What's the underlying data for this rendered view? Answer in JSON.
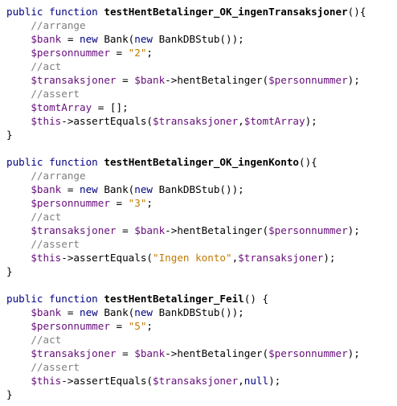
{
  "colors": {
    "keyword": "#000080",
    "variable": "#660e7a",
    "string": "#c07a00",
    "comment": "#808080",
    "background": "#ffffff",
    "text": "#000000"
  },
  "lines": [
    {
      "indent": false,
      "tokens": [
        [
          "kw",
          "public"
        ],
        [
          "p",
          " "
        ],
        [
          "kw",
          "function"
        ],
        [
          "p",
          " "
        ],
        [
          "fn",
          "testHentBetalinger_OK_ingenTransaksjoner"
        ],
        [
          "p",
          "(){"
        ]
      ]
    },
    {
      "indent": true,
      "tokens": [
        [
          "c",
          "//arrange"
        ]
      ]
    },
    {
      "indent": true,
      "tokens": [
        [
          "v",
          "$bank"
        ],
        [
          "p",
          " = "
        ],
        [
          "kw",
          "new"
        ],
        [
          "p",
          " Bank("
        ],
        [
          "kw",
          "new"
        ],
        [
          "p",
          " BankDBStub());"
        ]
      ]
    },
    {
      "indent": true,
      "tokens": [
        [
          "v",
          "$personnummer"
        ],
        [
          "p",
          " = "
        ],
        [
          "s",
          "\"2\""
        ],
        [
          "p",
          ";"
        ]
      ]
    },
    {
      "indent": true,
      "tokens": [
        [
          "c",
          "//act"
        ]
      ]
    },
    {
      "indent": true,
      "tokens": [
        [
          "v",
          "$transaksjoner"
        ],
        [
          "p",
          " = "
        ],
        [
          "v",
          "$bank"
        ],
        [
          "p",
          "->hentBetalinger("
        ],
        [
          "v",
          "$personnummer"
        ],
        [
          "p",
          ");"
        ]
      ]
    },
    {
      "indent": true,
      "tokens": [
        [
          "c",
          "//assert"
        ]
      ]
    },
    {
      "indent": true,
      "tokens": [
        [
          "v",
          "$tomtArray"
        ],
        [
          "p",
          " = [];"
        ]
      ]
    },
    {
      "indent": true,
      "tokens": [
        [
          "v",
          "$this"
        ],
        [
          "p",
          "->assertEquals("
        ],
        [
          "v",
          "$transaksjoner"
        ],
        [
          "p",
          ","
        ],
        [
          "v",
          "$tomtArray"
        ],
        [
          "p",
          ");"
        ]
      ]
    },
    {
      "indent": false,
      "tokens": [
        [
          "p",
          "}"
        ]
      ]
    },
    {
      "indent": false,
      "tokens": []
    },
    {
      "indent": false,
      "tokens": [
        [
          "kw",
          "public"
        ],
        [
          "p",
          " "
        ],
        [
          "kw",
          "function"
        ],
        [
          "p",
          " "
        ],
        [
          "fn",
          "testHentBetalinger_OK_ingenKonto"
        ],
        [
          "p",
          "(){"
        ]
      ]
    },
    {
      "indent": true,
      "tokens": [
        [
          "c",
          "//arrange"
        ]
      ]
    },
    {
      "indent": true,
      "tokens": [
        [
          "v",
          "$bank"
        ],
        [
          "p",
          " = "
        ],
        [
          "kw",
          "new"
        ],
        [
          "p",
          " Bank("
        ],
        [
          "kw",
          "new"
        ],
        [
          "p",
          " BankDBStub());"
        ]
      ]
    },
    {
      "indent": true,
      "tokens": [
        [
          "v",
          "$personnummer"
        ],
        [
          "p",
          " = "
        ],
        [
          "s",
          "\"3\""
        ],
        [
          "p",
          ";"
        ]
      ]
    },
    {
      "indent": true,
      "tokens": [
        [
          "c",
          "//act"
        ]
      ]
    },
    {
      "indent": true,
      "tokens": [
        [
          "v",
          "$transaksjoner"
        ],
        [
          "p",
          " = "
        ],
        [
          "v",
          "$bank"
        ],
        [
          "p",
          "->hentBetalinger("
        ],
        [
          "v",
          "$personnummer"
        ],
        [
          "p",
          ");"
        ]
      ]
    },
    {
      "indent": true,
      "tokens": [
        [
          "c",
          "//assert"
        ]
      ]
    },
    {
      "indent": true,
      "tokens": [
        [
          "v",
          "$this"
        ],
        [
          "p",
          "->assertEquals("
        ],
        [
          "s",
          "\"Ingen konto\""
        ],
        [
          "p",
          ","
        ],
        [
          "v",
          "$transaksjoner"
        ],
        [
          "p",
          ");"
        ]
      ]
    },
    {
      "indent": false,
      "tokens": [
        [
          "p",
          "}"
        ]
      ]
    },
    {
      "indent": false,
      "tokens": []
    },
    {
      "indent": false,
      "tokens": [
        [
          "kw",
          "public"
        ],
        [
          "p",
          " "
        ],
        [
          "kw",
          "function"
        ],
        [
          "p",
          " "
        ],
        [
          "fn",
          "testHentBetalinger_Feil"
        ],
        [
          "p",
          "() {"
        ]
      ]
    },
    {
      "indent": true,
      "tokens": [
        [
          "v",
          "$bank"
        ],
        [
          "p",
          " = "
        ],
        [
          "kw",
          "new"
        ],
        [
          "p",
          " Bank("
        ],
        [
          "kw",
          "new"
        ],
        [
          "p",
          " BankDBStub());"
        ]
      ]
    },
    {
      "indent": true,
      "tokens": [
        [
          "v",
          "$personnummer"
        ],
        [
          "p",
          " = "
        ],
        [
          "s",
          "\"5\""
        ],
        [
          "p",
          ";"
        ]
      ]
    },
    {
      "indent": true,
      "tokens": [
        [
          "c",
          "//act"
        ]
      ]
    },
    {
      "indent": true,
      "tokens": [
        [
          "v",
          "$transaksjoner"
        ],
        [
          "p",
          " = "
        ],
        [
          "v",
          "$bank"
        ],
        [
          "p",
          "->hentBetalinger("
        ],
        [
          "v",
          "$personnummer"
        ],
        [
          "p",
          ");"
        ]
      ]
    },
    {
      "indent": true,
      "tokens": [
        [
          "c",
          "//assert"
        ]
      ]
    },
    {
      "indent": true,
      "tokens": [
        [
          "v",
          "$this"
        ],
        [
          "p",
          "->assertEquals("
        ],
        [
          "v",
          "$transaksjoner"
        ],
        [
          "p",
          ","
        ],
        [
          "kw",
          "null"
        ],
        [
          "p",
          ");"
        ]
      ]
    },
    {
      "indent": false,
      "tokens": [
        [
          "p",
          "}"
        ]
      ]
    }
  ]
}
